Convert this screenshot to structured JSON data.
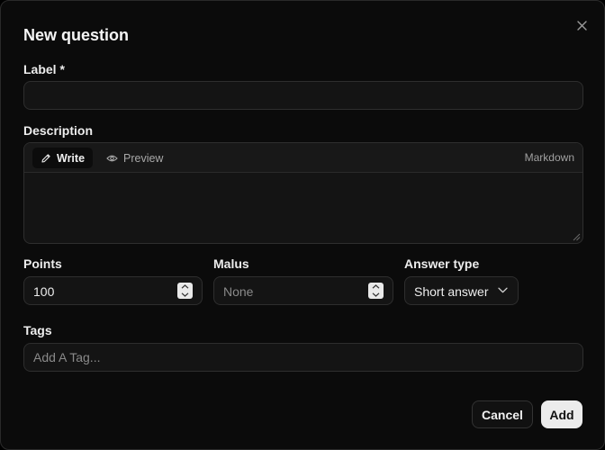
{
  "dialog": {
    "title": "New question",
    "close_icon": "close-icon"
  },
  "label_field": {
    "label": "Label *",
    "value": ""
  },
  "description_field": {
    "label": "Description",
    "tabs": [
      {
        "label": "Write",
        "icon": "pencil-icon",
        "active": true
      },
      {
        "label": "Preview",
        "icon": "eye-icon",
        "active": false
      }
    ],
    "mode": "Markdown",
    "value": ""
  },
  "points_field": {
    "label": "Points",
    "value": "100"
  },
  "malus_field": {
    "label": "Malus",
    "placeholder": "None"
  },
  "answer_type_field": {
    "label": "Answer type",
    "selected": "Short answer"
  },
  "tags_field": {
    "label": "Tags",
    "placeholder": "Add A Tag..."
  },
  "actions": {
    "cancel_label": "Cancel",
    "add_label": "Add"
  },
  "colors": {
    "background": "#0b0b0b",
    "field_bg": "#141414",
    "border": "#2e2e2e",
    "primary_button": "#ececec"
  }
}
